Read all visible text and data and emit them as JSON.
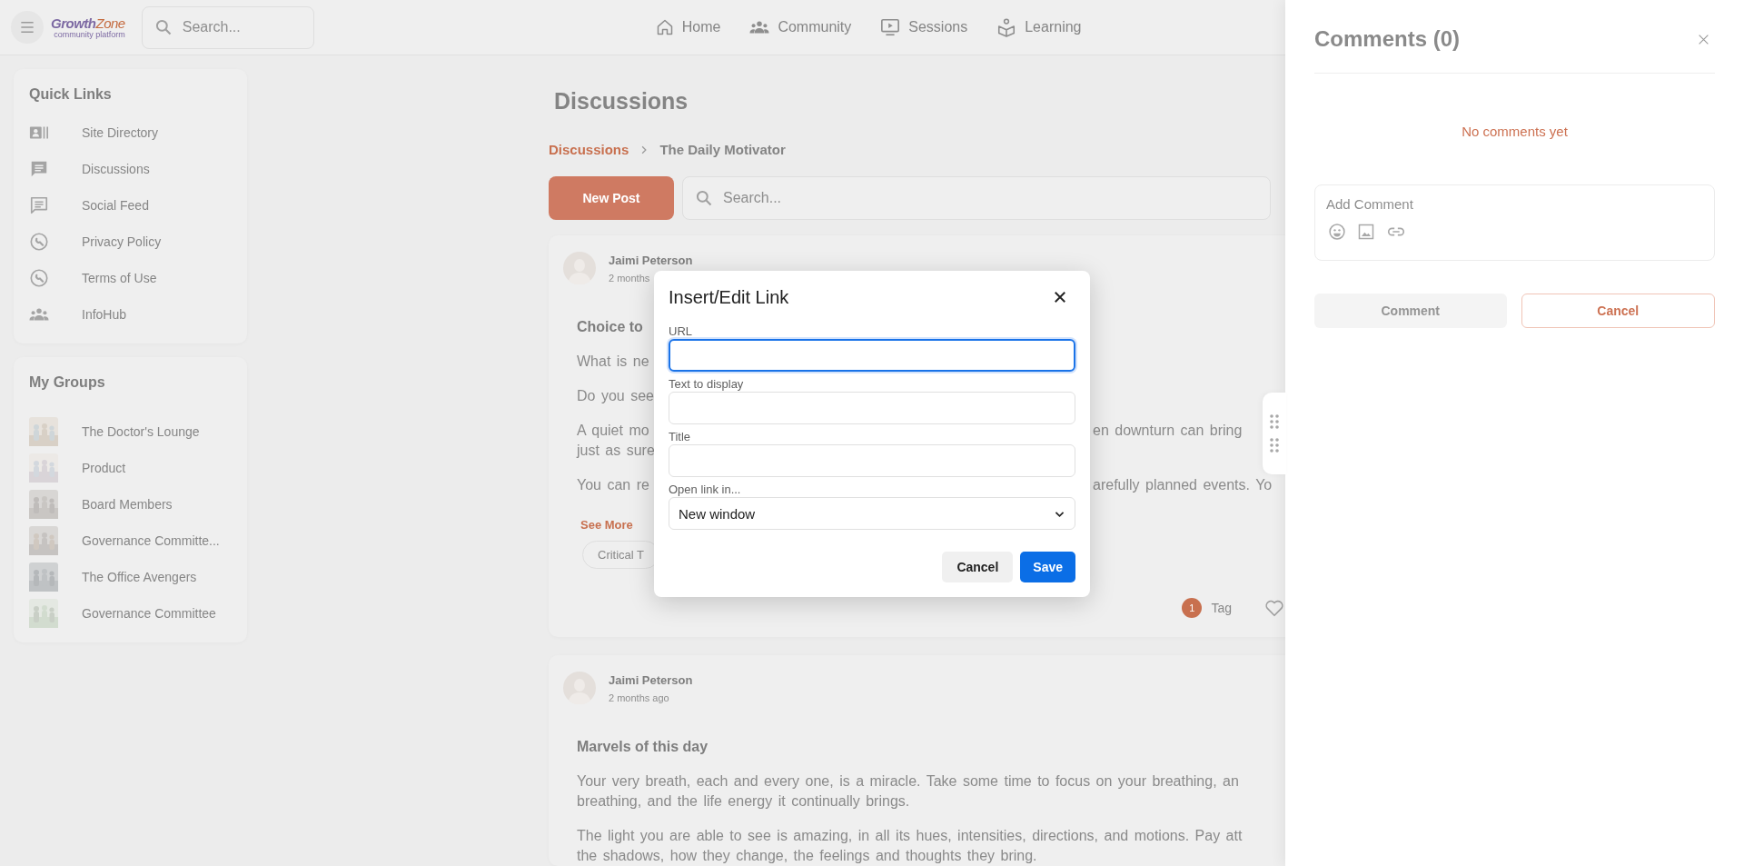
{
  "top_bar": {
    "logo": {
      "first": "Growth",
      "second": "Zone",
      "tagline": "community platform"
    },
    "search": {
      "placeholder": "Search..."
    },
    "nav": [
      {
        "label": "Home"
      },
      {
        "label": "Community"
      },
      {
        "label": "Sessions"
      },
      {
        "label": "Learning"
      }
    ]
  },
  "sidebar": {
    "quick_links": {
      "title": "Quick Links",
      "items": [
        "Site Directory",
        "Discussions",
        "Social Feed",
        "Privacy Policy",
        "Terms of Use",
        "InfoHub"
      ]
    },
    "my_groups": {
      "title": "My Groups",
      "items": [
        {
          "name": "The Doctor's Lounge",
          "kind": "picture"
        },
        {
          "name": "Product",
          "kind": "picture"
        },
        {
          "name": "Board Members",
          "kind": "picture"
        },
        {
          "name": "Governance Committe...",
          "kind": "picture"
        },
        {
          "name": "The Office Avengers",
          "kind": "picture"
        },
        {
          "name": "Governance Committee",
          "kind": "picture"
        }
      ]
    }
  },
  "main": {
    "title": "Discussions",
    "breadcrumb": [
      "Discussions",
      "The Daily Motivator"
    ],
    "new_post": "New Post",
    "search": {
      "placeholder": "Search..."
    },
    "posts": [
      {
        "author": "Jaimi Peterson",
        "time": "2 months",
        "title": "Choice to",
        "paragraphs": [
          [
            {
              "left": "What is ne"
            }
          ],
          [
            {
              "left": "Do you see"
            }
          ],
          [
            {
              "left": "A quiet mo",
              "right": "en downturn can bring"
            },
            {
              "left": "just as sure"
            }
          ],
          [
            {
              "left": "You can re",
              "right": "arefully planned events. Yo"
            }
          ]
        ],
        "see_more": "See More",
        "tags": [
          "Critical T"
        ],
        "tag_count": "1",
        "tag_label": "Tag"
      },
      {
        "author": "Jaimi Peterson",
        "time": "2 months ago",
        "title": "Marvels of this day",
        "paragraphs": [
          [
            {
              "left": "Your very breath, each and every one, is a miracle. Take some time to focus on your breathing, an"
            },
            {
              "left": "breathing, and the life energy it continually brings."
            }
          ],
          [
            {
              "left": "The light you are able to see is amazing, in all its hues, intensities, directions, and motions. Pay att"
            },
            {
              "left": "the shadows, how they change, the feelings and thoughts they bring."
            }
          ]
        ]
      }
    ]
  },
  "comments_panel": {
    "title": "Comments (0)",
    "empty": "No comments yet",
    "input": {
      "placeholder": "Add Comment"
    },
    "comment_button": {
      "label": "Comment",
      "disabled": true
    },
    "cancel_button": "Cancel"
  },
  "modal": {
    "title": "Insert/Edit Link",
    "fields": [
      {
        "label": "URL",
        "focused": true
      },
      {
        "label": "Text to display",
        "focused": false
      },
      {
        "label": "Title",
        "focused": false
      }
    ],
    "select": {
      "label": "Open link in...",
      "value": "New window"
    },
    "buttons": [
      {
        "label": "Cancel",
        "kind": "secondary"
      },
      {
        "label": "Save",
        "kind": "primary"
      }
    ]
  }
}
